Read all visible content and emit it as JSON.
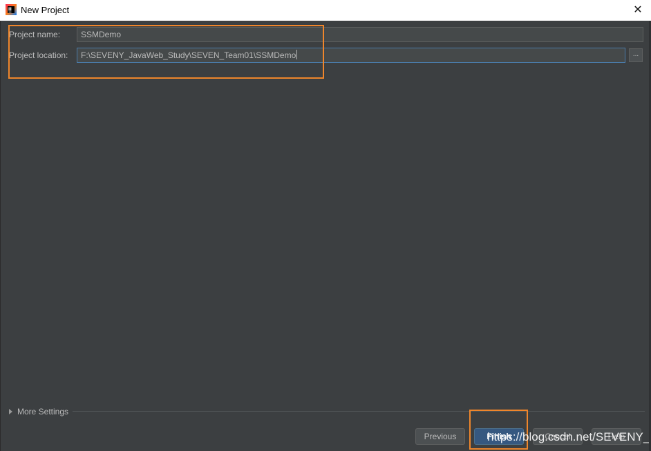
{
  "window": {
    "title": "New Project",
    "close_glyph": "✕"
  },
  "form": {
    "name_label": "Project name:",
    "name_value": "SSMDemo",
    "location_label": "Project location:",
    "location_value": "F:\\SEVENY_JavaWeb_Study\\SEVEN_Team01\\SSMDemo",
    "browse_label": "..."
  },
  "more_settings": {
    "label": "More Settings"
  },
  "buttons": {
    "previous": "Previous",
    "finish": "Finish",
    "cancel": "Cancel",
    "help": "Help"
  },
  "watermark": "https://blog.csdn.net/SEVENY_",
  "colors": {
    "background": "#3c3f41",
    "highlight": "#f0862b",
    "default_button": "#365880"
  },
  "icons": {
    "app": "intellij-idea-icon",
    "close": "close-icon",
    "more_settings": "triangle-right-icon"
  }
}
